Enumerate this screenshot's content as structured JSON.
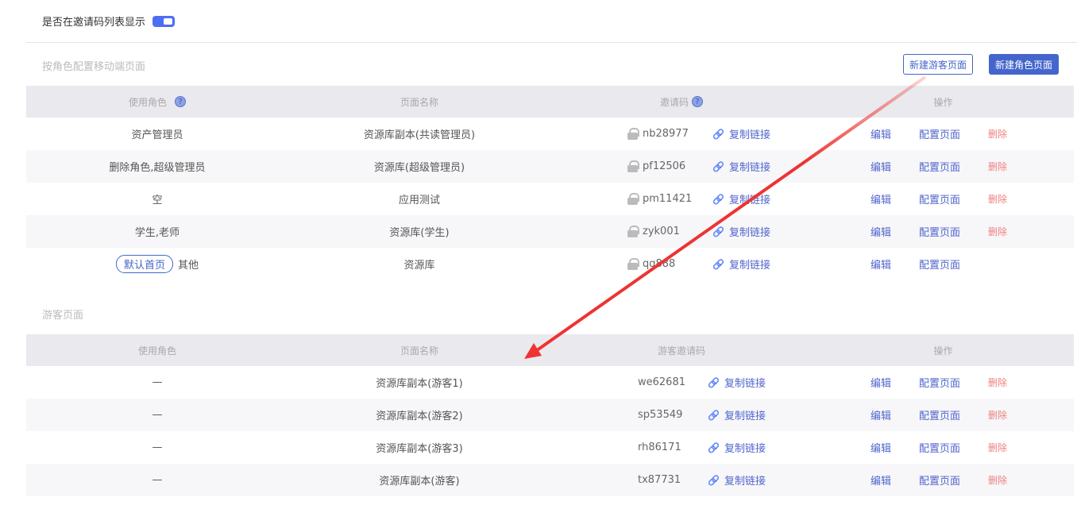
{
  "toggle": {
    "label": "是否在邀请码列表显示",
    "on": true
  },
  "role_section": {
    "title": "按角色配置移动端页面",
    "new_guest_button": "新建游客页面",
    "new_role_button": "新建角色页面",
    "headers": [
      "使用角色",
      "页面名称",
      "邀请码",
      "操作"
    ],
    "rows": [
      {
        "role": "资产管理员",
        "page": "资源库副本(共读管理员)",
        "code": "nb28977",
        "default_badge": null,
        "deletable": true
      },
      {
        "role": "删除角色,超级管理员",
        "page": "资源库(超级管理员)",
        "code": "pf12506",
        "default_badge": null,
        "deletable": true
      },
      {
        "role": "空",
        "page": "应用测试",
        "code": "pm11421",
        "default_badge": null,
        "deletable": true
      },
      {
        "role": "学生,老师",
        "page": "资源库(学生)",
        "code": "zyk001",
        "default_badge": null,
        "deletable": true
      },
      {
        "role": "其他",
        "page": "资源库",
        "code": "qq888",
        "default_badge": "默认首页",
        "deletable": false
      }
    ]
  },
  "guest_section": {
    "title": "游客页面",
    "headers": [
      "使用角色",
      "页面名称",
      "游客邀请码",
      "操作"
    ],
    "rows": [
      {
        "role": "—",
        "page": "资源库副本(游客1)",
        "code": "we62681"
      },
      {
        "role": "—",
        "page": "资源库副本(游客2)",
        "code": "sp53549"
      },
      {
        "role": "—",
        "page": "资源库副本(游客3)",
        "code": "rh86171"
      },
      {
        "role": "—",
        "page": "资源库副本(游客)",
        "code": "tx87731"
      }
    ]
  },
  "actions": {
    "copy": "复制链接",
    "edit": "编辑",
    "config": "配置页面",
    "delete": "删除"
  },
  "colors": {
    "accent": "#4466cc",
    "danger": "#f08080",
    "arrow": "#ee3333"
  }
}
